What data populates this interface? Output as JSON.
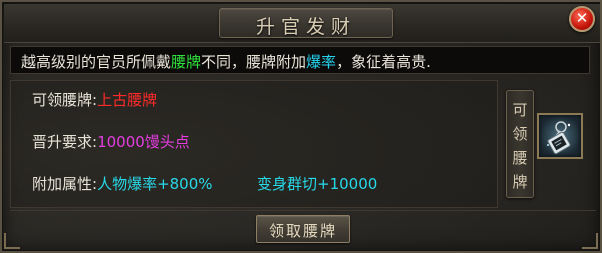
{
  "window": {
    "title": "升官发财",
    "close_icon": "close-icon"
  },
  "description": {
    "part1": "越高级别的官员所佩戴",
    "highlight1": "腰牌",
    "part2": "不同，腰牌附加",
    "highlight2": "爆率",
    "part3": "，象征着高贵."
  },
  "rows": {
    "badge_label": "可领腰牌:",
    "badge_value": "上古腰牌",
    "requirement_label": "晋升要求:",
    "requirement_value": "10000馒头点",
    "attribute_label": "附加属性:",
    "attribute_value_1": "人物爆率+800%",
    "attribute_value_2": "变身群切+10000"
  },
  "side_tab": {
    "chars": [
      "可",
      "领",
      "腰",
      "牌"
    ]
  },
  "item": {
    "icon": "waist-badge-icon"
  },
  "footer": {
    "claim_label": "领取腰牌"
  },
  "colors": {
    "highlight_green": "#2fe23c",
    "highlight_cyan": "#26d3f0",
    "value_red": "#ff2a2a",
    "value_magenta": "#e43de0",
    "value_cyan": "#27d8e8"
  }
}
